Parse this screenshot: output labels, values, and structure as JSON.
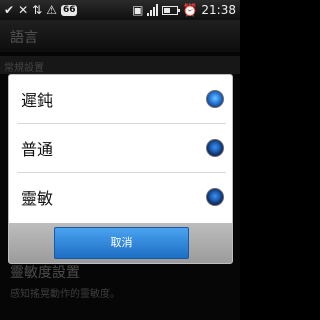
{
  "status_bar": {
    "icons": {
      "check": "check-icon",
      "no_signal": "x-signal-icon",
      "transfer": "transfer-icon",
      "warning": "warning-icon",
      "sim": "sim-icon",
      "signal": "signal-bars-icon",
      "battery": "battery-icon",
      "alarm": "alarm-icon"
    },
    "badge": "66",
    "time": "21:38",
    "battery_level": 0.5
  },
  "background": {
    "title": "語言",
    "section": "常規設置",
    "setting_title": "靈敏度設置",
    "setting_subtitle": "感知搖晃動作的靈敏度。"
  },
  "dialog": {
    "options": [
      {
        "label": "遲鈍",
        "selected": true
      },
      {
        "label": "普通",
        "selected": false
      },
      {
        "label": "靈敏",
        "selected": false
      }
    ],
    "cancel_label": "取消"
  },
  "colors": {
    "accent": "#2a7fe0",
    "dialog_bg": "#ffffff",
    "footer": "#a8a8a8"
  }
}
